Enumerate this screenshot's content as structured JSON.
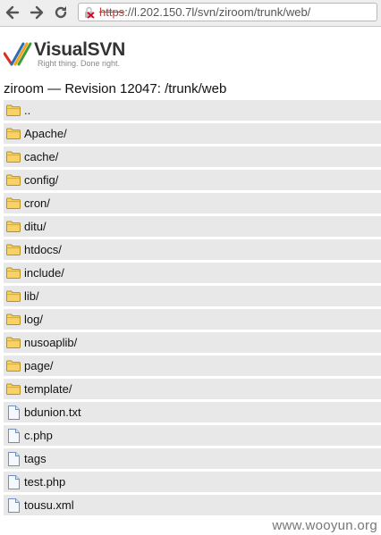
{
  "browser": {
    "url_scheme": "https",
    "url_rest": "://l.202.150.7l/svn/ziroom/trunk/web/"
  },
  "brand": {
    "name": "VisualSVN",
    "tagline": "Right thing. Done right."
  },
  "page": {
    "title": "ziroom — Revision 12047: /trunk/web"
  },
  "entries": [
    {
      "name": "..",
      "type": "folder"
    },
    {
      "name": "Apache/",
      "type": "folder"
    },
    {
      "name": "cache/",
      "type": "folder"
    },
    {
      "name": "config/",
      "type": "folder"
    },
    {
      "name": "cron/",
      "type": "folder"
    },
    {
      "name": "ditu/",
      "type": "folder"
    },
    {
      "name": "htdocs/",
      "type": "folder"
    },
    {
      "name": "include/",
      "type": "folder"
    },
    {
      "name": "lib/",
      "type": "folder"
    },
    {
      "name": "log/",
      "type": "folder"
    },
    {
      "name": "nusoaplib/",
      "type": "folder"
    },
    {
      "name": "page/",
      "type": "folder"
    },
    {
      "name": "template/",
      "type": "folder"
    },
    {
      "name": "bdunion.txt",
      "type": "file"
    },
    {
      "name": "c.php",
      "type": "file"
    },
    {
      "name": "tags",
      "type": "file"
    },
    {
      "name": "test.php",
      "type": "file"
    },
    {
      "name": "tousu.xml",
      "type": "file"
    }
  ],
  "watermark": "www.wooyun.org"
}
